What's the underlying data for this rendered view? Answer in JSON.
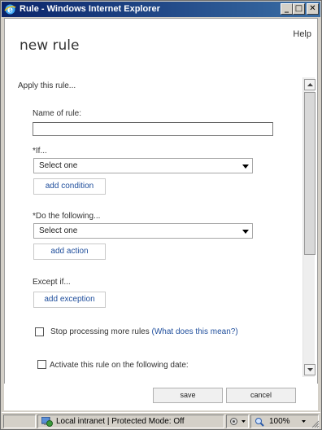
{
  "window": {
    "title": "Rule - Windows Internet Explorer",
    "min_glyph": "_",
    "max_glyph": "□",
    "close_glyph": "✕"
  },
  "page": {
    "help": "Help",
    "title": "new rule",
    "apply_label": "Apply this rule..."
  },
  "form": {
    "name_label": "Name of rule:",
    "name_value": "",
    "if_label": "*If...",
    "if_select": "Select one",
    "add_condition": "add condition",
    "do_label": "*Do the following...",
    "do_select": "Select one",
    "add_action": "add action",
    "except_label": "Except if...",
    "add_exception": "add exception",
    "stop_label": "Stop processing more rules",
    "stop_link": "(What does this mean?)",
    "activate_label": "Activate this rule on the following date:"
  },
  "footer": {
    "save": "save",
    "cancel": "cancel"
  },
  "statusbar": {
    "zone": "Local intranet | Protected Mode: Off",
    "zoom": "100%"
  }
}
